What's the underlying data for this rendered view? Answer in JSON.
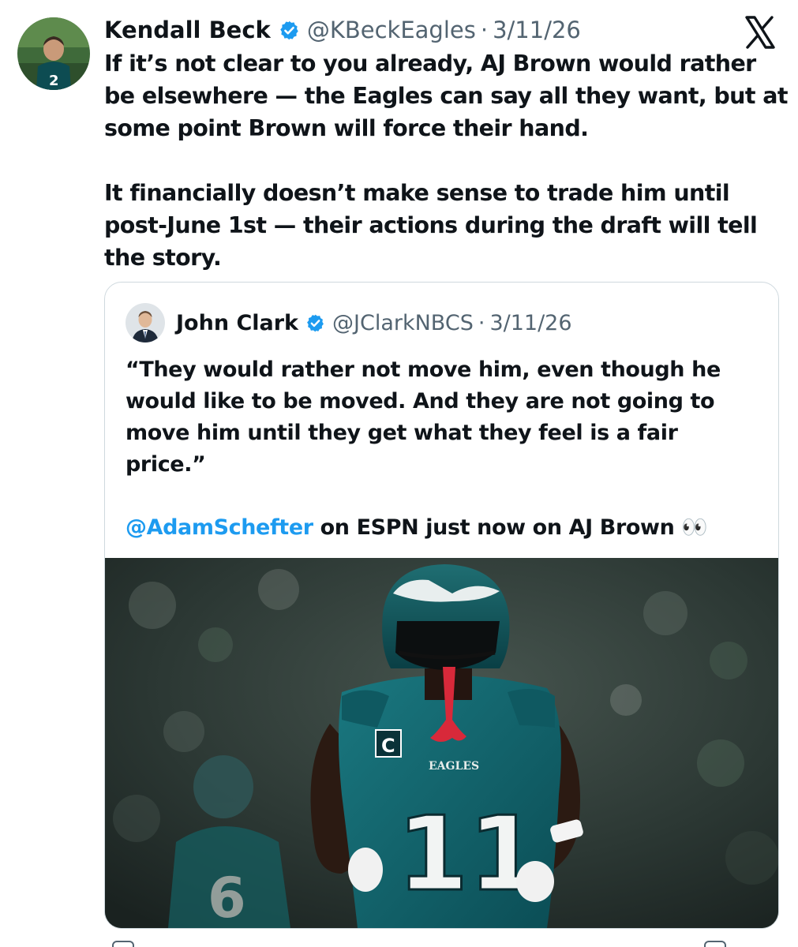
{
  "tweet": {
    "author_name": "Kendall Beck",
    "author_handle": "@KBeckEagles",
    "separator": "·",
    "date": "3/11/26",
    "paragraph_1": "If it’s not clear to you already, AJ Brown would rather be elsewhere — the Eagles can say all they want, but at some point Brown will force their hand.",
    "paragraph_2": "It financially doesn’t make sense to trade him until post-June 1st — their actions during the draft will tell the story."
  },
  "quoted_tweet": {
    "author_name": "John Clark",
    "author_handle": "@JClarkNBCS",
    "separator": "·",
    "date": "3/11/26",
    "paragraph_1": "“They would rather not move him, even though he would like to be moved. And they are not going to move him until they get what they feel is a fair price.”",
    "mention": "@AdamSchefter",
    "paragraph_2_rest": " on ESPN just now on AJ Brown ",
    "emoji": "👀",
    "photo": {
      "jersey_number": "11",
      "captain_patch": "C",
      "chest_wordmark": "EAGLES",
      "background_jersey_number": "6"
    }
  },
  "icons": {
    "verified": "verified-badge-icon",
    "platform": "x-logo-icon"
  },
  "colors": {
    "text_primary": "#0f1419",
    "text_secondary": "#536471",
    "link": "#1d9bf0",
    "verified": "#1d9bf0",
    "card_border": "#cfd9de",
    "eagles_green": "#0d5c63"
  }
}
